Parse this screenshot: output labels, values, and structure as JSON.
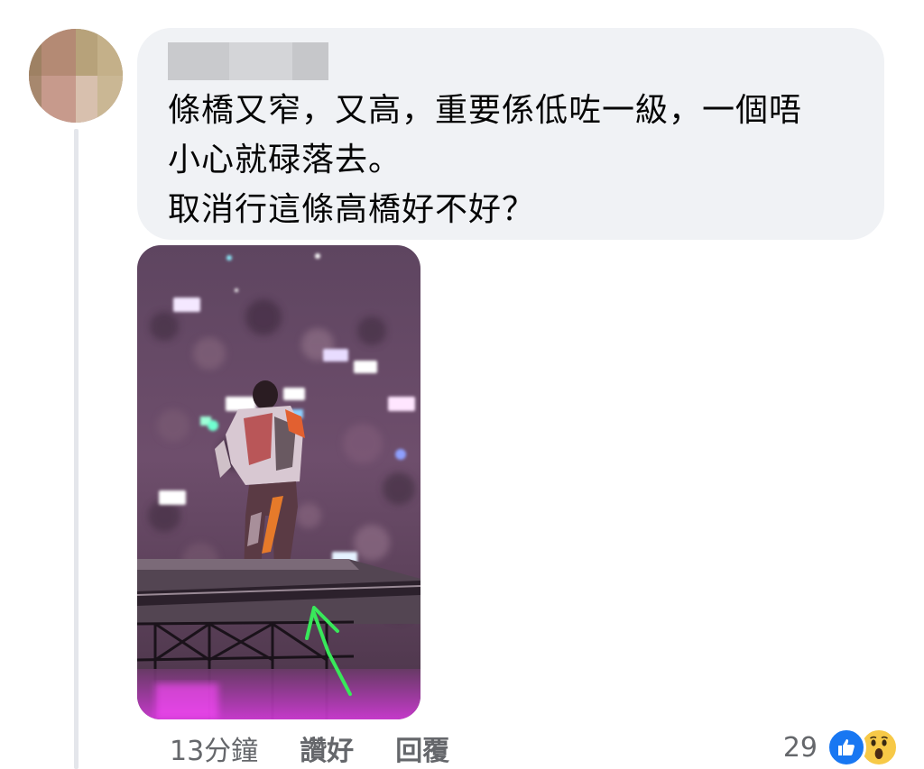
{
  "comment": {
    "text_lines": [
      "條橋又窄，又高，重要係低咗一級，一個唔",
      "小心就碌落去。",
      "取消行這條高橋好不好？"
    ]
  },
  "actions": {
    "timestamp": "13分鐘",
    "like_label": "讚好",
    "reply_label": "回覆"
  },
  "reactions": {
    "count": "29",
    "types": [
      "like-icon",
      "wow-icon"
    ],
    "like_color": "#1877f2",
    "wow_color": "#f7c947"
  },
  "colors": {
    "bubble": "#f0f2f5",
    "text": "#050505",
    "secondary_text": "#65676b"
  }
}
